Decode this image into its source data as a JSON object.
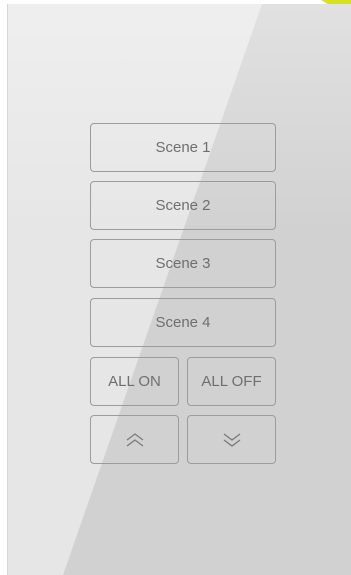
{
  "panel": {
    "scenes": [
      "Scene 1",
      "Scene 2",
      "Scene 3",
      "Scene 4"
    ],
    "all_on_label": "ALL ON",
    "all_off_label": "ALL OFF",
    "up_icon": "double-chevron-up-icon",
    "down_icon": "double-chevron-down-icon"
  },
  "colors": {
    "accent": "#d6e21a",
    "panel_light": "#e6e6e6",
    "panel_shadow": "#d2d1d1",
    "button_border": "#9c9c9c",
    "button_text": "#6f6f6f"
  }
}
